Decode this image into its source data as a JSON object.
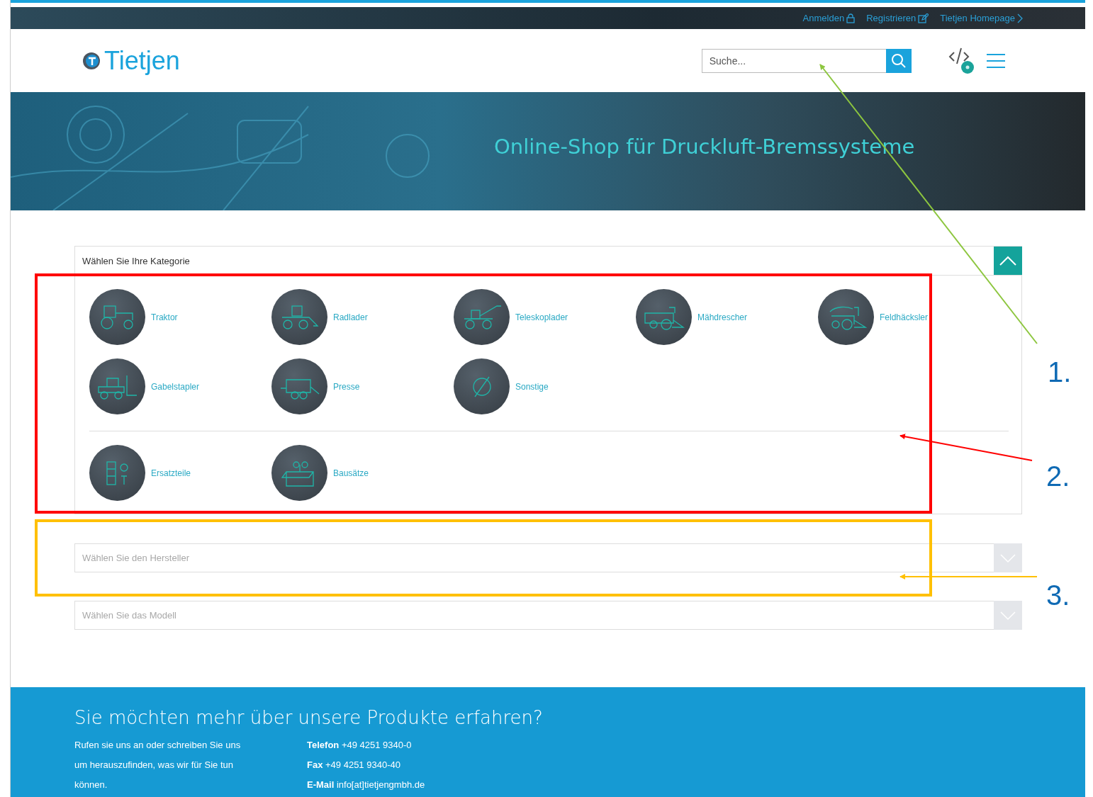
{
  "top_bar": {
    "links": [
      {
        "label": "Anmelden",
        "kind": "login"
      },
      {
        "label": "Registrieren",
        "kind": "register"
      },
      {
        "label": "Tietjen Homepage",
        "kind": "homepage"
      }
    ]
  },
  "header": {
    "logo": "Tietjen",
    "search": {
      "placeholder": "Suche..."
    }
  },
  "banner": {
    "title": "Online-Shop für Druckluft-Bremssysteme"
  },
  "category_panel": {
    "title": "Wählen Sie Ihre Kategorie",
    "expanded": true,
    "groups": [
      [
        {
          "label": "Traktor",
          "kind": "tractor"
        },
        {
          "label": "Radlader",
          "kind": "loader"
        },
        {
          "label": "Teleskoplader",
          "kind": "telehandler"
        },
        {
          "label": "Mähdrescher",
          "kind": "combine"
        },
        {
          "label": "Feldhäcksler",
          "kind": "forager"
        },
        {
          "label": "Gabelstapler",
          "kind": "forklift"
        },
        {
          "label": "Presse",
          "kind": "baler"
        },
        {
          "label": "Sonstige",
          "kind": "other"
        }
      ],
      [
        {
          "label": "Ersatzteile",
          "kind": "parts"
        },
        {
          "label": "Bausätze",
          "kind": "kits"
        }
      ]
    ]
  },
  "dropdowns": [
    {
      "placeholder": "Wählen Sie den Hersteller",
      "disabled": true
    },
    {
      "placeholder": "Wählen Sie das Modell",
      "disabled": true
    }
  ],
  "footer": {
    "heading": "Sie möchten mehr über unsere Produkte erfahren?",
    "text": "Rufen sie uns an oder schreiben Sie uns um herauszufinden, was wir für Sie tun können.",
    "contacts": [
      {
        "label": "Telefon",
        "value": "+49 4251 9340-0"
      },
      {
        "label": "Fax",
        "value": "+49 4251 9340-40"
      },
      {
        "label": "E-Mail",
        "value": "info[at]tietjengmbh.de"
      }
    ]
  },
  "annotations": [
    {
      "label": "1.",
      "color": "#8dc63f"
    },
    {
      "label": "2.",
      "color": "#ff0000"
    },
    {
      "label": "3.",
      "color": "#ffc000"
    }
  ]
}
